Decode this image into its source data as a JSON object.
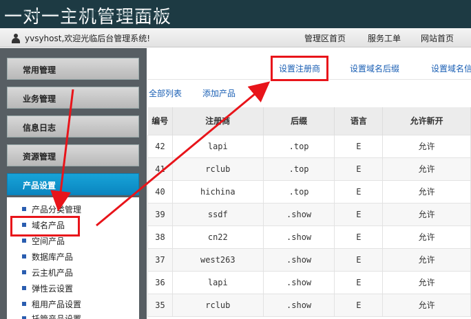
{
  "banner": {
    "title": "一对一主机管理面板"
  },
  "topbar": {
    "welcome": "yvsyhost,欢迎光临后台管理系统!",
    "links": [
      "管理区首页",
      "服务工单",
      "网站首页"
    ]
  },
  "sidebar": {
    "groups": [
      "常用管理",
      "业务管理",
      "信息日志",
      "资源管理",
      "产品设置"
    ],
    "sub_items": [
      "产品分类管理",
      "域名产品",
      "空间产品",
      "数据库产品",
      "云主机产品",
      "弹性云设置",
      "租用产品设置",
      "托管产品设置"
    ]
  },
  "main": {
    "tabs": [
      "设置注册商",
      "设置域名后缀",
      "设置域名信"
    ],
    "actions": [
      "全部列表",
      "添加产品"
    ],
    "table": {
      "headers": [
        "编号",
        "注册商",
        "后缀",
        "语言",
        "允许新开"
      ],
      "rows": [
        [
          "42",
          "lapi",
          ".top",
          "E",
          "允许"
        ],
        [
          "41",
          "rclub",
          ".top",
          "E",
          "允许"
        ],
        [
          "40",
          "hichina",
          ".top",
          "E",
          "允许"
        ],
        [
          "39",
          "ssdf",
          ".show",
          "E",
          "允许"
        ],
        [
          "38",
          "cn22",
          ".show",
          "E",
          "允许"
        ],
        [
          "37",
          "west263",
          ".show",
          "E",
          "允许"
        ],
        [
          "36",
          "lapi",
          ".show",
          "E",
          "允许"
        ],
        [
          "35",
          "rclub",
          ".show",
          "E",
          "允许"
        ]
      ]
    }
  },
  "colors": {
    "banner_bg": "#1d3a43",
    "sidebar_bg": "#575e63",
    "active_menu": "#0a86c0",
    "link": "#1a5fb4",
    "annotation": "#e8141a"
  }
}
